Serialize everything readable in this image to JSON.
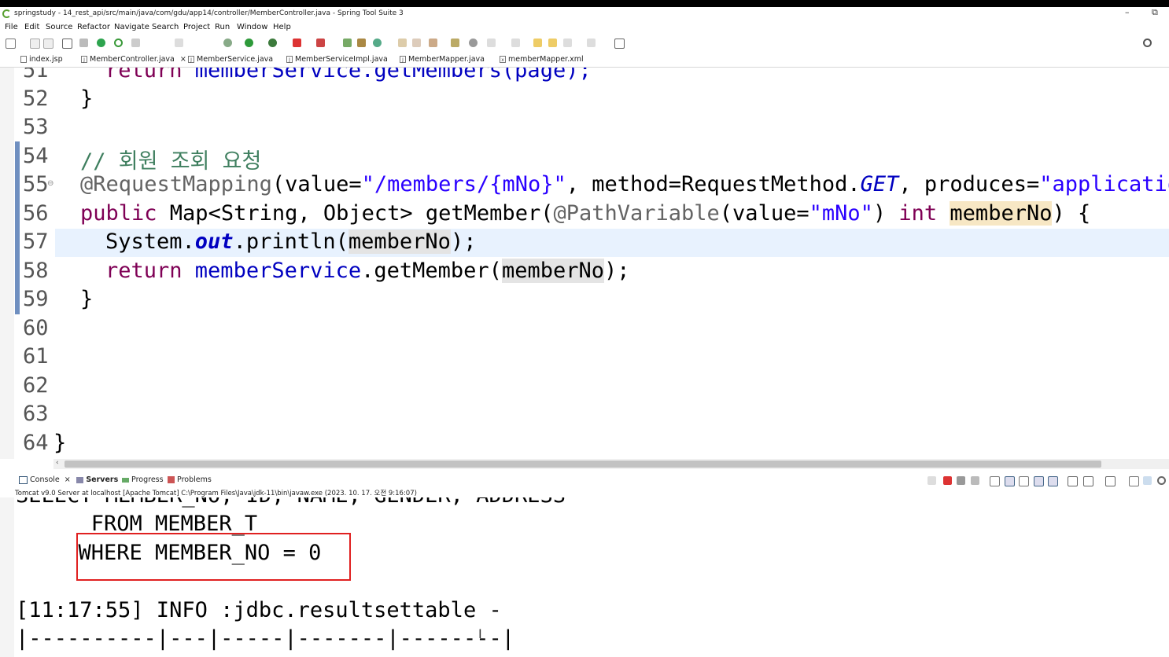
{
  "window": {
    "title": "springstudy - 14_rest_api/src/main/java/com/gdu/app14/controller/MemberController.java - Spring Tool Suite 3",
    "minimize": "–",
    "restore": "⧉"
  },
  "menu": [
    "File",
    "Edit",
    "Source",
    "Refactor",
    "Navigate",
    "Search",
    "Project",
    "Run",
    "Window",
    "Help"
  ],
  "tabs": [
    {
      "label": "index.jsp",
      "icon": "jsp-file-icon"
    },
    {
      "label": "MemberController.java",
      "icon": "java-file-icon",
      "active": true,
      "close": "×"
    },
    {
      "label": "MemberService.java",
      "icon": "java-file-icon"
    },
    {
      "label": "MemberServiceImpl.java",
      "icon": "java-file-icon"
    },
    {
      "label": "MemberMapper.java",
      "icon": "java-file-icon"
    },
    {
      "label": "memberMapper.xml",
      "icon": "xml-file-icon"
    }
  ],
  "editor": {
    "line_numbers": [
      "51",
      "52",
      "53",
      "54",
      "55",
      "56",
      "57",
      "58",
      "59",
      "60",
      "61",
      "62",
      "63",
      "64"
    ],
    "fold_marker": "⊖",
    "code": {
      "l51_ret": "return ",
      "l51_rest": "memberService.getMembers(page);",
      "l52": "}",
      "l54": "// 회원 조회 요청",
      "l55_ann": "@RequestMapping",
      "l55_a": "(value=",
      "l55_s1": "\"/members/{mNo}\"",
      "l55_b": ", method=RequestMethod.",
      "l55_get": "GET",
      "l55_c": ", produces=",
      "l55_s2": "\"application",
      "l56_pub": "public ",
      "l56_a": "Map<String, Object> getMember(",
      "l56_ann": "@PathVariable",
      "l56_b": "(value=",
      "l56_s": "\"mNo\"",
      "l56_c": ") ",
      "l56_int": "int ",
      "l56_var": "memberNo",
      "l56_d": ") {",
      "l57_a": "System.",
      "l57_out": "out",
      "l57_b": ".println(",
      "l57_var": "memberNo",
      "l57_c": ");",
      "l58_ret": "return ",
      "l58_fld": "memberService",
      "l58_a": ".getMember(",
      "l58_var": "memberNo",
      "l58_b": ");",
      "l59": "}",
      "l64": "}"
    }
  },
  "console_tabs": [
    {
      "label": "Console",
      "icon": "console-icon",
      "close": "×"
    },
    {
      "label": "Servers",
      "icon": "servers-icon"
    },
    {
      "label": "Progress",
      "icon": "progress-icon"
    },
    {
      "label": "Problems",
      "icon": "problems-icon"
    }
  ],
  "console": {
    "description": "Tomcat v9.0 Server at localhost [Apache Tomcat] C:\\Program Files\\Java\\jdk-11\\bin\\javaw.exe  (2023. 10. 17. 오전 9:16:07)",
    "lines": [
      "SELECT MEMBER_NO, ID, NAME, GENDER, ADDRESS",
      "   FROM MEMBER_T",
      "  WHERE MEMBER_NO = 0",
      "",
      "[11:17:55] INFO :jdbc.resultsettable -",
      "|----------|---|-----|-------|--------|"
    ]
  },
  "colors": {
    "keyword": "#7f0055",
    "comment": "#3f7f5f",
    "string": "#2a00ff",
    "field": "#0000c0",
    "annotation": "#646464",
    "highlight_box": "#e02020"
  }
}
